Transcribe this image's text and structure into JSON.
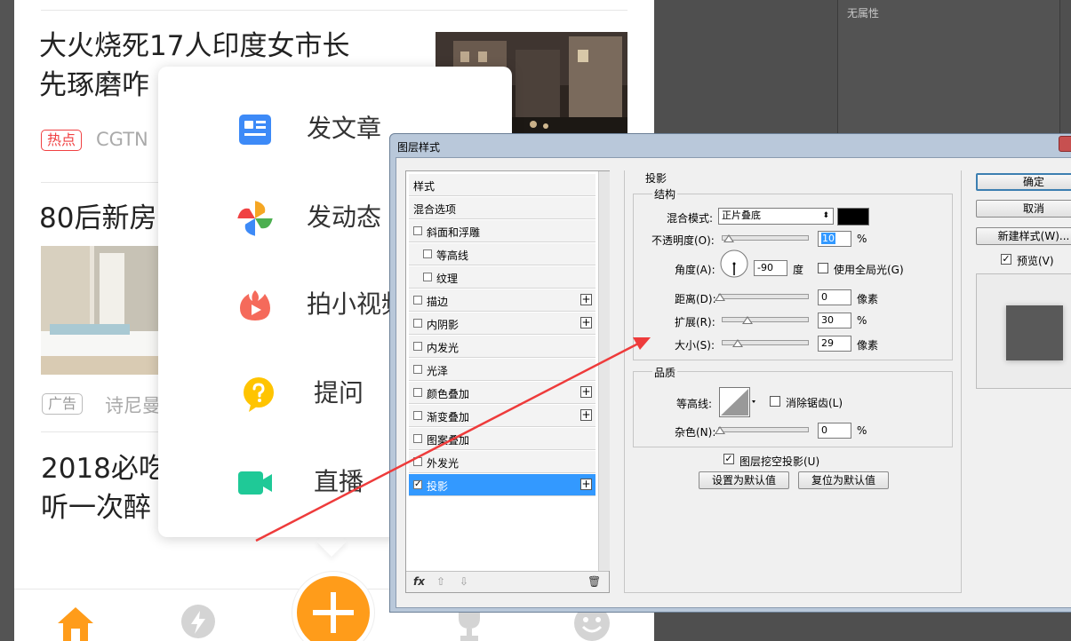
{
  "feed": {
    "items": [
      {
        "title_line1": "大火烧死17人印度女市长",
        "title_line2": "先琢磨咋",
        "tag": "热点",
        "source": "CGTN"
      },
      {
        "title_line1": "80后新房",
        "tag": "广告",
        "source": "诗尼曼"
      },
      {
        "title_line1": "2018必吃",
        "title_line2": "听一次醉"
      }
    ]
  },
  "popup_menu": {
    "items": [
      {
        "label": "发文章",
        "icon": "article-icon"
      },
      {
        "label": "发动态",
        "icon": "pinwheel-icon"
      },
      {
        "label": "拍小视频",
        "icon": "flame-play-icon"
      },
      {
        "label": "提问",
        "icon": "question-bubble-icon"
      },
      {
        "label": "直播",
        "icon": "video-camera-icon"
      }
    ]
  },
  "tabbar": {
    "tabs": [
      "home-icon",
      "bolt-icon",
      "trophy-icon",
      "smiley-icon"
    ],
    "fab_icon": "plus-icon",
    "accent": "#ff9c1a"
  },
  "ps_panel": {
    "properties_label": "无属性"
  },
  "dialog": {
    "title": "图层样式",
    "styles_header": "样式",
    "style_items": [
      {
        "label": "混合选项",
        "checkbox": false,
        "plus": false,
        "indent": 0,
        "checked": false,
        "selected": false
      },
      {
        "label": "斜面和浮雕",
        "checkbox": true,
        "plus": false,
        "indent": 0,
        "checked": false,
        "selected": false
      },
      {
        "label": "等高线",
        "checkbox": true,
        "plus": false,
        "indent": 1,
        "checked": false,
        "selected": false
      },
      {
        "label": "纹理",
        "checkbox": true,
        "plus": false,
        "indent": 1,
        "checked": false,
        "selected": false
      },
      {
        "label": "描边",
        "checkbox": true,
        "plus": true,
        "indent": 0,
        "checked": false,
        "selected": false
      },
      {
        "label": "内阴影",
        "checkbox": true,
        "plus": true,
        "indent": 0,
        "checked": false,
        "selected": false
      },
      {
        "label": "内发光",
        "checkbox": true,
        "plus": false,
        "indent": 0,
        "checked": false,
        "selected": false
      },
      {
        "label": "光泽",
        "checkbox": true,
        "plus": false,
        "indent": 0,
        "checked": false,
        "selected": false
      },
      {
        "label": "颜色叠加",
        "checkbox": true,
        "plus": true,
        "indent": 0,
        "checked": false,
        "selected": false
      },
      {
        "label": "渐变叠加",
        "checkbox": true,
        "plus": true,
        "indent": 0,
        "checked": false,
        "selected": false
      },
      {
        "label": "图案叠加",
        "checkbox": true,
        "plus": false,
        "indent": 0,
        "checked": false,
        "selected": false
      },
      {
        "label": "外发光",
        "checkbox": true,
        "plus": false,
        "indent": 0,
        "checked": false,
        "selected": false
      },
      {
        "label": "投影",
        "checkbox": true,
        "plus": true,
        "indent": 0,
        "checked": true,
        "selected": true
      }
    ],
    "footer": {
      "fx": "fx",
      "up": "⇧",
      "down": "⇩",
      "trash": "🗑"
    },
    "section_title": "投影",
    "structure": {
      "title": "结构",
      "blend_mode_label": "混合模式:",
      "blend_mode_value": "正片叠底",
      "shadow_color": "#000000",
      "opacity_label": "不透明度(O):",
      "opacity_value": "10",
      "opacity_unit": "%",
      "angle_label": "角度(A):",
      "angle_value": "-90",
      "angle_unit": "度",
      "global_light_label": "使用全局光(G)",
      "distance_label": "距离(D):",
      "distance_value": "0",
      "distance_unit": "像素",
      "spread_label": "扩展(R):",
      "spread_value": "30",
      "spread_unit": "%",
      "size_label": "大小(S):",
      "size_value": "29",
      "size_unit": "像素"
    },
    "quality": {
      "title": "品质",
      "contour_label": "等高线:",
      "anti_alias_label": "消除锯齿(L)",
      "noise_label": "杂色(N):",
      "noise_value": "0",
      "noise_unit": "%"
    },
    "knockout_label": "图层挖空投影(U)",
    "make_default_label": "设置为默认值",
    "reset_default_label": "复位为默认值",
    "buttons": {
      "ok": "确定",
      "cancel": "取消",
      "new_style": "新建样式(W)..."
    },
    "preview_label": "预览(V)"
  }
}
